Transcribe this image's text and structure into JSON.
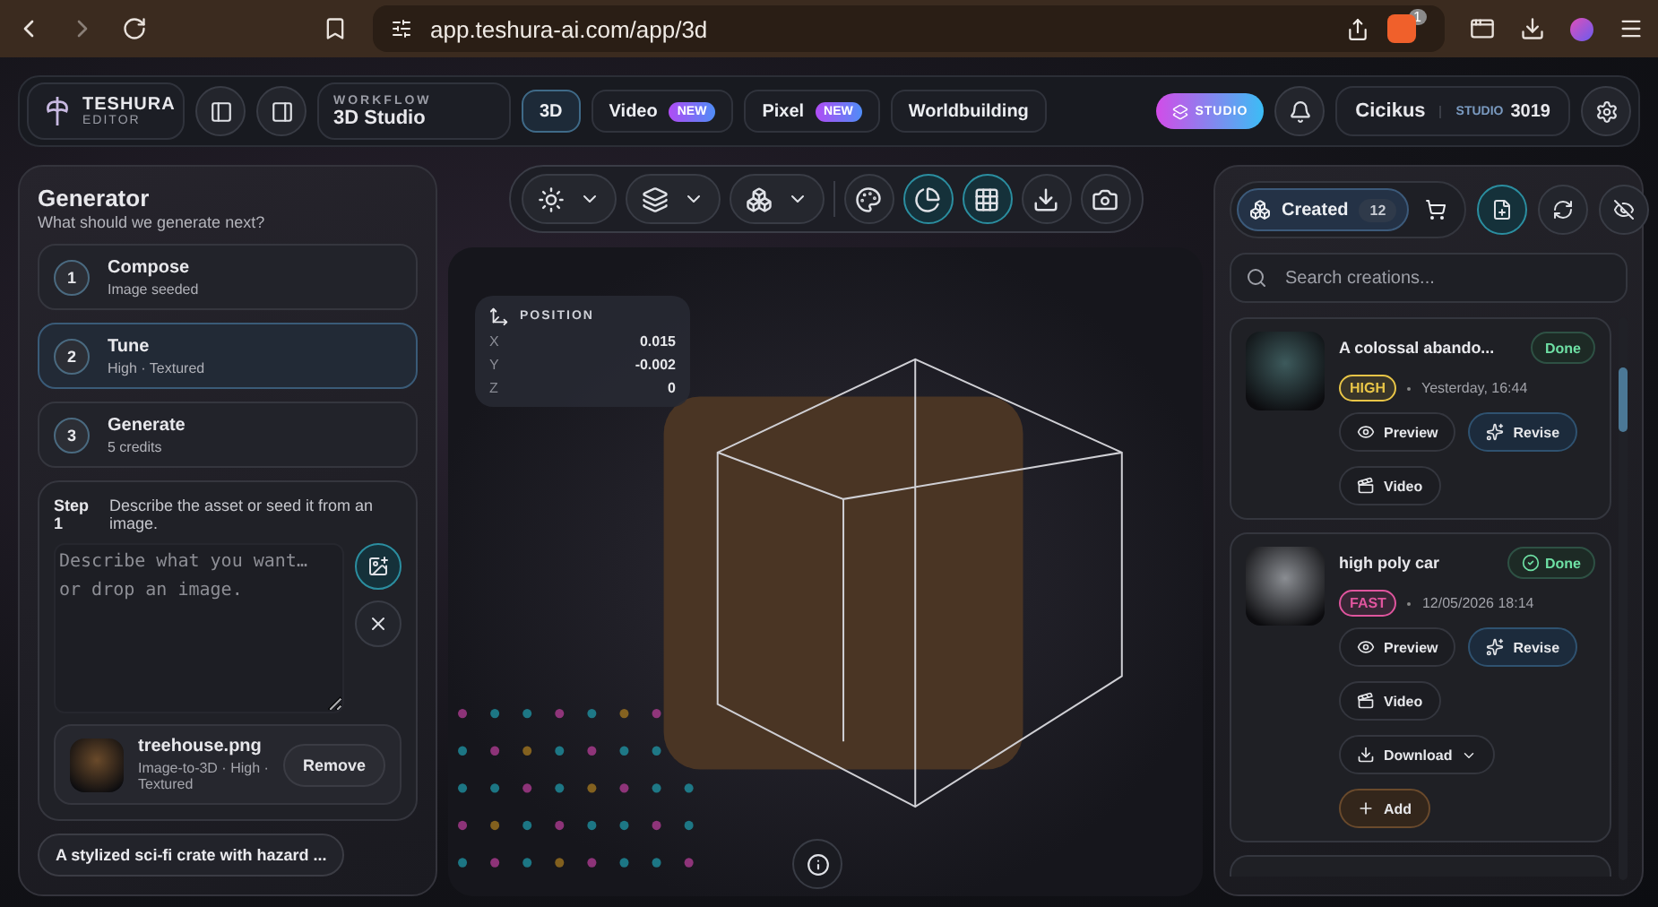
{
  "browser": {
    "url": "app.teshura-ai.com/app/3d",
    "shield_badge": "1"
  },
  "header": {
    "brand": {
      "name": "TESHURA",
      "sub": "EDITOR"
    },
    "workflow": {
      "label": "WORKFLOW",
      "value": "3D Studio"
    },
    "tabs": [
      {
        "label": "3D",
        "selected": true
      },
      {
        "label": "Video",
        "badge": "NEW",
        "selected": false
      },
      {
        "label": "Pixel",
        "badge": "NEW",
        "selected": false
      },
      {
        "label": "Worldbuilding",
        "selected": false
      }
    ],
    "studio_pill": "STUDIO",
    "user": {
      "name": "Cicikus",
      "plan": "STUDIO",
      "credits": "3019"
    }
  },
  "generator": {
    "title": "Generator",
    "subtitle": "What should we generate next?",
    "steps": [
      {
        "number": "1",
        "title": "Compose",
        "detail": "Image seeded",
        "selected": false
      },
      {
        "number": "2",
        "title": "Tune",
        "detail": "High · Textured",
        "selected": true
      },
      {
        "number": "3",
        "title": "Generate",
        "detail": "5 credits",
        "selected": false
      }
    ],
    "step_card": {
      "label": "Step 1",
      "hint": "Describe the asset or seed it from an image.",
      "placeholder": "Describe what you want… or drop an image.",
      "file": {
        "name": "treehouse.png",
        "meta": "Image-to-3D · High · Textured",
        "action": "Remove"
      }
    },
    "suggestion": "A stylized sci-fi crate with hazard ..."
  },
  "viewport": {
    "toolbar": [
      {
        "kind": "dropdown",
        "active": false
      },
      {
        "kind": "dropdown",
        "active": false
      },
      {
        "kind": "dropdown",
        "active": false
      },
      {
        "kind": "button",
        "active": false
      },
      {
        "kind": "button",
        "active": true
      },
      {
        "kind": "button",
        "active": true
      },
      {
        "kind": "button",
        "active": false
      },
      {
        "kind": "button",
        "active": false
      }
    ],
    "position": {
      "title": "POSITION",
      "rows": [
        {
          "axis": "X",
          "value": "0.015"
        },
        {
          "axis": "Y",
          "value": "-0.002"
        },
        {
          "axis": "Z",
          "value": "0"
        }
      ]
    }
  },
  "library": {
    "tabs": [
      {
        "kind": "created",
        "label": "Created",
        "count": "12",
        "selected": true
      },
      {
        "kind": "cart",
        "selected": false
      }
    ],
    "search_placeholder": "Search creations...",
    "cards": [
      {
        "title": "A colossal abando...",
        "status": "Done",
        "status_icon": false,
        "tag": "HIGH",
        "color": "#e8c547",
        "time": "Yesterday, 16:44",
        "actions": [
          {
            "kind": "preview",
            "label": "Preview"
          },
          {
            "kind": "revise",
            "label": "Revise"
          },
          {
            "kind": "video",
            "label": "Video"
          }
        ]
      },
      {
        "title": "high poly car",
        "status": "Done",
        "status_icon": true,
        "tag": "FAST",
        "color": "#e0559e",
        "time": "12/05/2026 18:14",
        "actions": [
          {
            "kind": "preview",
            "label": "Preview"
          },
          {
            "kind": "revise",
            "label": "Revise"
          },
          {
            "kind": "video",
            "label": "Video"
          },
          {
            "kind": "download",
            "label": "Download"
          },
          {
            "kind": "add",
            "label": "Add"
          }
        ]
      }
    ]
  }
}
